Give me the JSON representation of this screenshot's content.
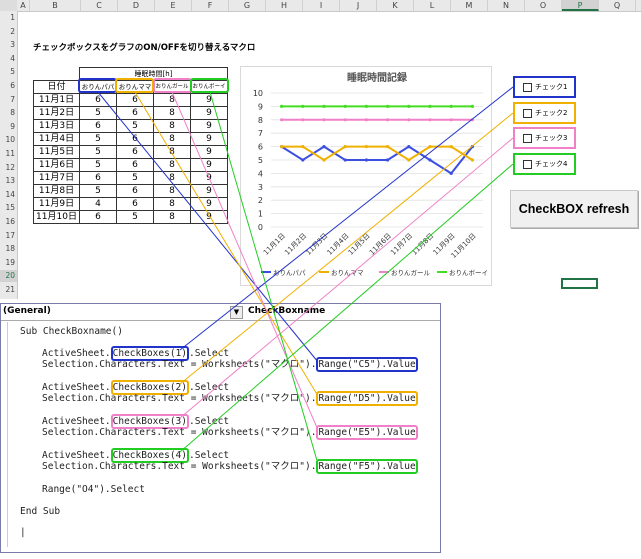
{
  "columns": [
    "A",
    "B",
    "C",
    "D",
    "E",
    "F",
    "G",
    "H",
    "I",
    "J",
    "K",
    "L",
    "M",
    "N",
    "O",
    "P",
    "Q"
  ],
  "selected_column": "P",
  "rows": [
    "1",
    "2",
    "3",
    "4",
    "5",
    "6",
    "7",
    "8",
    "9",
    "10",
    "11",
    "12",
    "13",
    "14",
    "15",
    "16",
    "17",
    "18",
    "19",
    "20",
    "21"
  ],
  "selected_row": "20",
  "sheet_title": "チェックボックスをグラフのON/OFFを切り替えるマクロ",
  "table": {
    "group_header": "睡眠時間[h]",
    "date_header": "日付",
    "series_headers": [
      "おりんパパ",
      "おりんママ",
      "おりんガール",
      "おりんボーイ"
    ],
    "rows": [
      {
        "date": "11月1日",
        "values": [
          "6",
          "6",
          "8",
          "9"
        ]
      },
      {
        "date": "11月2日",
        "values": [
          "5",
          "6",
          "8",
          "9"
        ]
      },
      {
        "date": "11月3日",
        "values": [
          "6",
          "5",
          "8",
          "9"
        ]
      },
      {
        "date": "11月4日",
        "values": [
          "5",
          "6",
          "8",
          "9"
        ]
      },
      {
        "date": "11月5日",
        "values": [
          "5",
          "6",
          "8",
          "9"
        ]
      },
      {
        "date": "11月6日",
        "values": [
          "5",
          "6",
          "8",
          "9"
        ]
      },
      {
        "date": "11月7日",
        "values": [
          "6",
          "5",
          "8",
          "9"
        ]
      },
      {
        "date": "11月8日",
        "values": [
          "5",
          "6",
          "8",
          "9"
        ]
      },
      {
        "date": "11月9日",
        "values": [
          "4",
          "6",
          "8",
          "9"
        ]
      },
      {
        "date": "11月10日",
        "values": [
          "6",
          "5",
          "8",
          "9"
        ]
      }
    ]
  },
  "chart_data": {
    "type": "line",
    "title": "睡眠時間記録",
    "categories": [
      "11月1日",
      "11月2日",
      "11月3日",
      "11月4日",
      "11月5日",
      "11月6日",
      "11月7日",
      "11月8日",
      "11月9日",
      "11月10日"
    ],
    "series": [
      {
        "name": "おりんパパ",
        "color": "#3b4fe0",
        "values": [
          6,
          5,
          6,
          5,
          5,
          5,
          6,
          5,
          4,
          6
        ]
      },
      {
        "name": "おりんママ",
        "color": "#f0b000",
        "values": [
          6,
          6,
          5,
          6,
          6,
          6,
          5,
          6,
          6,
          5
        ]
      },
      {
        "name": "おりんガール",
        "color": "#f080c8",
        "values": [
          8,
          8,
          8,
          8,
          8,
          8,
          8,
          8,
          8,
          8
        ]
      },
      {
        "name": "おりんボーイ",
        "color": "#44dd22",
        "values": [
          9,
          9,
          9,
          9,
          9,
          9,
          9,
          9,
          9,
          9
        ]
      }
    ],
    "ylim": [
      0,
      10
    ],
    "yticks": [
      "0",
      "1",
      "2",
      "3",
      "4",
      "5",
      "6",
      "7",
      "8",
      "9",
      "10"
    ],
    "grid": true,
    "legend": "bottom"
  },
  "checkboxes": [
    {
      "label": "チェック1",
      "color": "#2233cc"
    },
    {
      "label": "チェック2",
      "color": "#f0b000"
    },
    {
      "label": "チェック3",
      "color": "#f080c8"
    },
    {
      "label": "チェック4",
      "color": "#22cc22"
    }
  ],
  "refresh_button": "CheckBOX refresh",
  "vba": {
    "object_dropdown": "(General)",
    "dropdown_arrow": "▼",
    "procedure_dropdown": "CheckBoxname",
    "sub_start": "Sub CheckBoxname()",
    "blocks": [
      {
        "pre": "ActiveSheet.",
        "cb": "CheckBoxes(1)",
        "post": ".Select",
        "line2_pre": "Selection.Characters.Text = Worksheets(\"マクロ\").",
        "range": "Range(\"C5\").Value"
      },
      {
        "pre": "ActiveSheet.",
        "cb": "CheckBoxes(2)",
        "post": ".Select",
        "line2_pre": "Selection.Characters.Text = Worksheets(\"マクロ\").",
        "range": "Range(\"D5\").Value"
      },
      {
        "pre": "ActiveSheet.",
        "cb": "CheckBoxes(3)",
        "post": ".Select",
        "line2_pre": "Selection.Characters.Text = Worksheets(\"マクロ\").",
        "range": "Range(\"E5\").Value"
      },
      {
        "pre": "ActiveSheet.",
        "cb": "CheckBoxes(4)",
        "post": ".Select",
        "line2_pre": "Selection.Characters.Text = Worksheets(\"マクロ\").",
        "range": "Range(\"F5\").Value"
      }
    ],
    "select_line": "Range(\"O4\").Select",
    "sub_end": "End Sub",
    "cursor": "|"
  },
  "colors": {
    "blue": "#2233cc",
    "yellow": "#f0b000",
    "pink": "#f080c8",
    "green": "#22cc22",
    "grid": "#e0e0e0"
  }
}
